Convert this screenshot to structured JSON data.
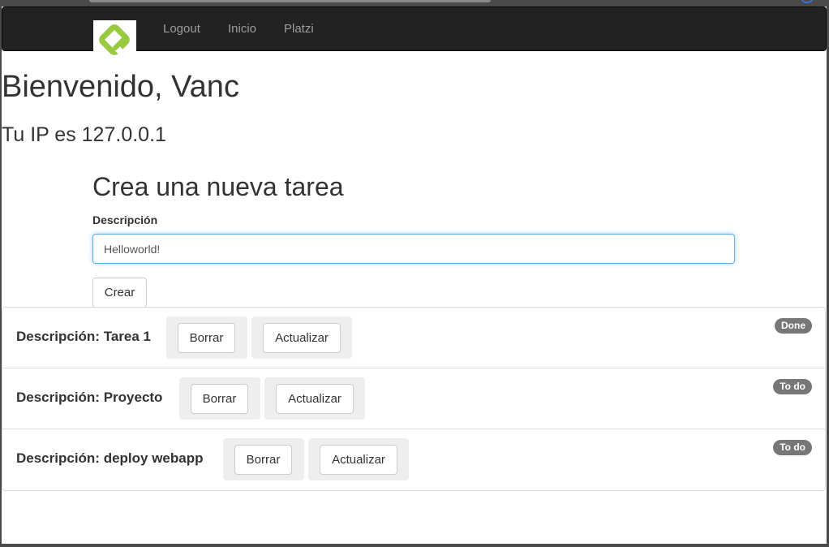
{
  "nav": {
    "logo_icon": "platzi-logo-icon",
    "links": [
      "Logout",
      "Inicio",
      "Platzi"
    ]
  },
  "welcome": "Bienvenido, Vanc",
  "ip_text": "Tu IP es 127.0.0.1",
  "form": {
    "title": "Crea una nueva tarea",
    "label": "Descripción",
    "input_value": "Helloworld!",
    "submit_label": "Crear"
  },
  "tasks": [
    {
      "description": "Descripción: Tarea 1",
      "delete_label": "Borrar",
      "update_label": "Actualizar",
      "status": "Done"
    },
    {
      "description": "Descripción: Proyecto",
      "delete_label": "Borrar",
      "update_label": "Actualizar",
      "status": "To do"
    },
    {
      "description": "Descripción: deploy webapp",
      "delete_label": "Borrar",
      "update_label": "Actualizar",
      "status": "To do"
    }
  ],
  "colors": {
    "navbar": "#222222",
    "logo_green": "#98ca3f",
    "badge": "#777777",
    "input_focus": "#66afe9"
  }
}
